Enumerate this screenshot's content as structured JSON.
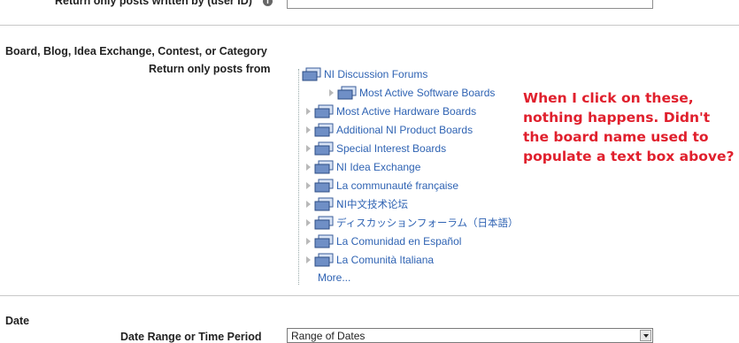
{
  "author_row": {
    "label": "Return only posts written by (user ID)",
    "info_icon": "i"
  },
  "board_section": {
    "heading": "Board, Blog, Idea Exchange, Contest, or Category",
    "sublabel": "Return only posts from",
    "tree": {
      "root": "NI Discussion Forums",
      "items": [
        "Most Active Software Boards",
        "Most Active Hardware Boards",
        "Additional NI Product Boards",
        "Special Interest Boards",
        "NI Idea Exchange",
        "La communauté française",
        "NI中文技术论坛",
        "ディスカッションフォーラム（日本語）",
        "La Comunidad en Español",
        "La Comunità Italiana"
      ],
      "more": "More..."
    },
    "annotation": "When I click on these,\nnothing happens. Didn't\nthe board name used to\npopulate a text box above?"
  },
  "date_section": {
    "heading": "Date",
    "range_label": "Date Range or Time Period",
    "range_value": "Range of Dates"
  },
  "colors": {
    "link": "#2f63b3",
    "annotation": "#e0202d",
    "folder_blue": "#3a5d9a"
  }
}
